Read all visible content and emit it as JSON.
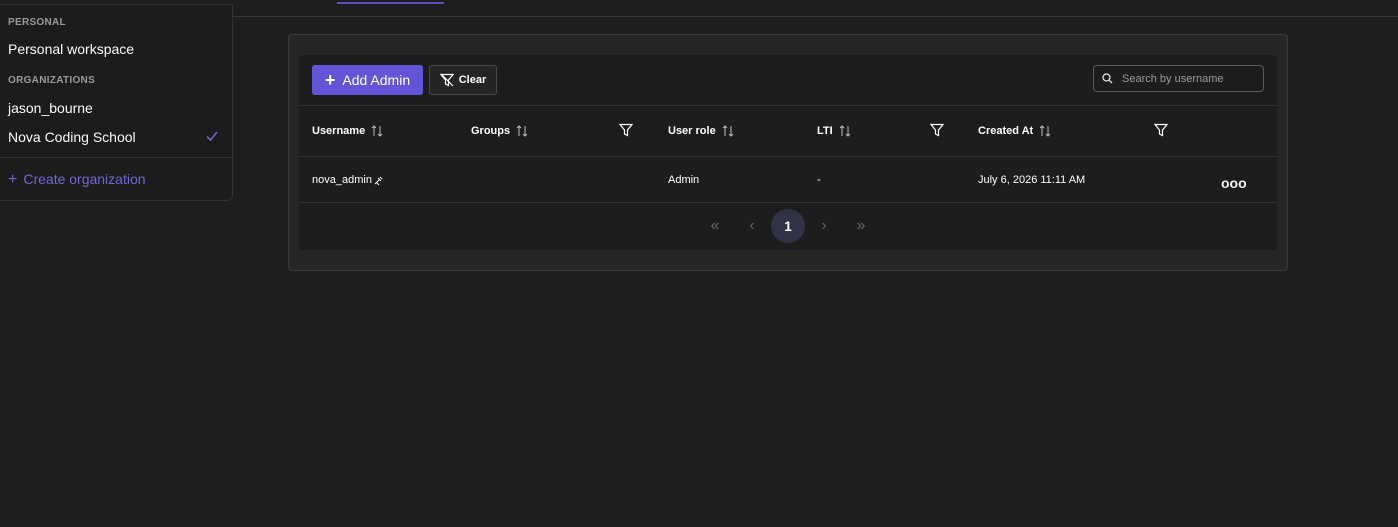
{
  "dropdown": {
    "personal_label": "PERSONAL",
    "personal_workspace": "Personal workspace",
    "organizations_label": "ORGANIZATIONS",
    "organizations": [
      {
        "name": "jason_bourne",
        "selected": false
      },
      {
        "name": "Nova Coding School",
        "selected": true
      }
    ],
    "create_org": "Create organization"
  },
  "toolbar": {
    "add_admin": "Add Admin",
    "clear": "Clear",
    "search_placeholder": "Search by username"
  },
  "table": {
    "columns": [
      "Username",
      "Groups",
      "User role",
      "LTI",
      "Created At"
    ],
    "rows": [
      {
        "username": "nova_admin",
        "groups": "",
        "role": "Admin",
        "lti": "-",
        "created_at": "July 6, 2026 11:11 AM",
        "actions": "ooo"
      }
    ]
  },
  "pagination": {
    "current_page": "1",
    "first": "«",
    "prev": "‹",
    "next": "›",
    "last": "»"
  },
  "colors": {
    "accent": "#6355d6",
    "background": "#1e1e1e",
    "card": "#262626"
  }
}
